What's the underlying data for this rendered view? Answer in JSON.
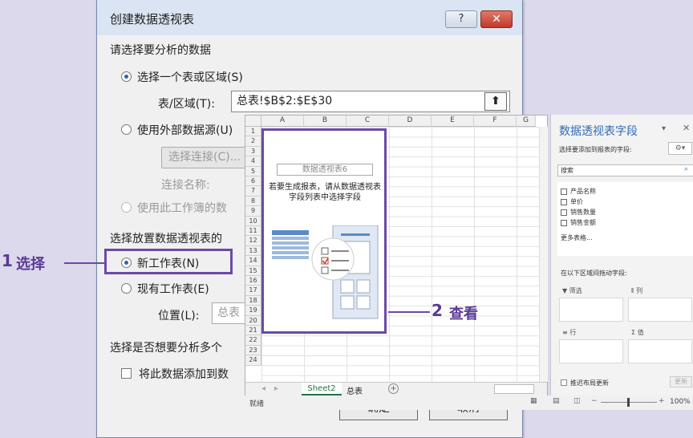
{
  "dialog": {
    "title": "创建数据透视表",
    "help": "?",
    "close": "✕",
    "section1": "请选择要分析的数据",
    "opt_select_range": "选择一个表或区域(S)",
    "range_label": "表/区域(T):",
    "range_value": "总表!$B$2:$E$30",
    "opt_external": "使用外部数据源(U)",
    "choose_conn": "选择连接(C)...",
    "conn_name": "连接名称:",
    "opt_data_model": "使用此工作簿的数",
    "section2": "选择放置数据透视表的",
    "opt_new_sheet": "新工作表(N)",
    "opt_existing_sheet": "现有工作表(E)",
    "location_label": "位置(L):",
    "location_value": "总表",
    "section3": "选择是否想要分析多个",
    "add_to_model": "将此数据添加到数",
    "ok": "确定",
    "cancel": "取消"
  },
  "callouts": {
    "step1_num": "1",
    "step1_text": "选择",
    "step2_num": "2",
    "step2_text": "查看"
  },
  "sheet": {
    "columns": [
      "A",
      "B",
      "C",
      "D",
      "E",
      "F",
      "G"
    ],
    "rows": [
      "1",
      "2",
      "3",
      "4",
      "5",
      "6",
      "7",
      "8",
      "9",
      "10",
      "11",
      "12",
      "13",
      "14",
      "15",
      "16",
      "17",
      "18",
      "19",
      "20",
      "21",
      "22",
      "23",
      "24"
    ],
    "pivot_name": "数据透视表6",
    "pivot_hint": "若要生成报表，请从数据透视表字段列表中选择字段",
    "tab_active": "Sheet2",
    "tab_other": "总表",
    "status": "就绪",
    "zoom": "100%"
  },
  "pane": {
    "title": "数据透视表字段",
    "subtitle": "选择要添加到报表的字段:",
    "search": "搜索",
    "fields": [
      "产品名称",
      "单价",
      "销售数量",
      "销售金额"
    ],
    "more_tables": "更多表格...",
    "drag_label": "在以下区域间拖动字段:",
    "zone_filter": "筛选",
    "zone_columns": "列",
    "zone_rows": "行",
    "zone_values": "值",
    "defer_update": "推迟布局更新",
    "update": "更新"
  },
  "colors": {
    "accent": "#6a4aa8",
    "link": "#2f6db5"
  }
}
